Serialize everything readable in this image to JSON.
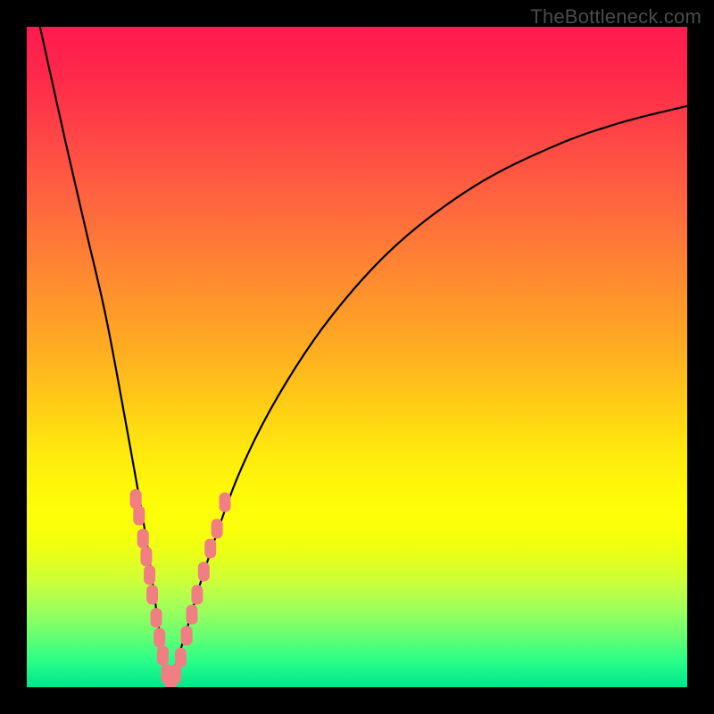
{
  "watermark": "TheBottleneck.com",
  "chart_data": {
    "type": "line",
    "title": "",
    "xlabel": "",
    "ylabel": "",
    "xlim": [
      0,
      1
    ],
    "ylim": [
      0,
      1
    ],
    "notch_x": 0.215,
    "curve_left": {
      "name": "left-branch",
      "points": [
        {
          "x": 0.02,
          "y": 1.0
        },
        {
          "x": 0.06,
          "y": 0.82
        },
        {
          "x": 0.09,
          "y": 0.69
        },
        {
          "x": 0.12,
          "y": 0.56
        },
        {
          "x": 0.15,
          "y": 0.4
        },
        {
          "x": 0.18,
          "y": 0.23
        },
        {
          "x": 0.2,
          "y": 0.09
        },
        {
          "x": 0.215,
          "y": 0.0
        }
      ]
    },
    "curve_right": {
      "name": "right-branch",
      "points": [
        {
          "x": 0.215,
          "y": 0.0
        },
        {
          "x": 0.24,
          "y": 0.08
        },
        {
          "x": 0.27,
          "y": 0.18
        },
        {
          "x": 0.32,
          "y": 0.32
        },
        {
          "x": 0.38,
          "y": 0.44
        },
        {
          "x": 0.46,
          "y": 0.56
        },
        {
          "x": 0.56,
          "y": 0.67
        },
        {
          "x": 0.68,
          "y": 0.76
        },
        {
          "x": 0.8,
          "y": 0.82
        },
        {
          "x": 0.9,
          "y": 0.855
        },
        {
          "x": 1.0,
          "y": 0.88
        }
      ]
    },
    "highlight_points": {
      "name": "highlight-dots",
      "color": "#f17e83",
      "points": [
        {
          "x": 0.165,
          "y": 0.285
        },
        {
          "x": 0.17,
          "y": 0.26
        },
        {
          "x": 0.176,
          "y": 0.225
        },
        {
          "x": 0.181,
          "y": 0.198
        },
        {
          "x": 0.186,
          "y": 0.17
        },
        {
          "x": 0.19,
          "y": 0.14
        },
        {
          "x": 0.196,
          "y": 0.105
        },
        {
          "x": 0.201,
          "y": 0.075
        },
        {
          "x": 0.206,
          "y": 0.048
        },
        {
          "x": 0.212,
          "y": 0.02
        },
        {
          "x": 0.218,
          "y": 0.008
        },
        {
          "x": 0.225,
          "y": 0.02
        },
        {
          "x": 0.233,
          "y": 0.045
        },
        {
          "x": 0.242,
          "y": 0.078
        },
        {
          "x": 0.25,
          "y": 0.11
        },
        {
          "x": 0.258,
          "y": 0.14
        },
        {
          "x": 0.268,
          "y": 0.175
        },
        {
          "x": 0.278,
          "y": 0.21
        },
        {
          "x": 0.288,
          "y": 0.24
        },
        {
          "x": 0.3,
          "y": 0.28
        }
      ]
    }
  }
}
